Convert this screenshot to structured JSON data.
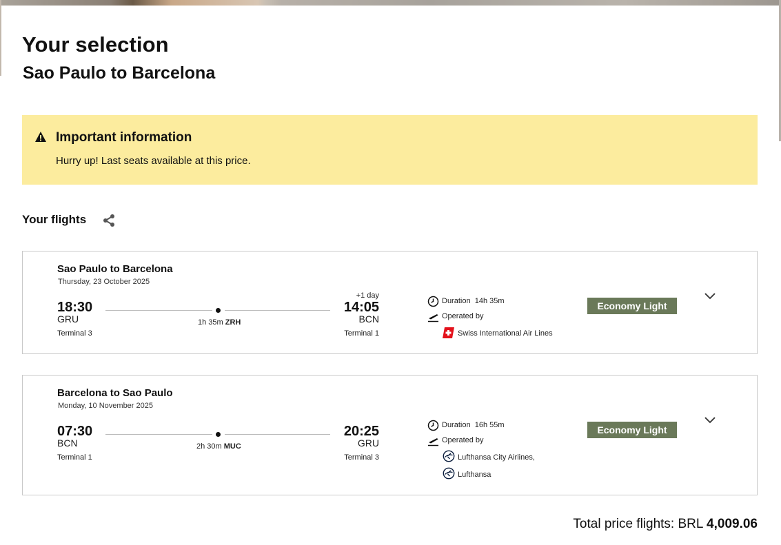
{
  "header": {
    "title": "Your selection",
    "subtitle": "Sao Paulo to Barcelona"
  },
  "info": {
    "icon": "warning-icon",
    "title": "Important information",
    "text": "Hurry up! Last seats available at this price.",
    "background": "#fcec9e"
  },
  "flights_section": {
    "title": "Your flights",
    "share_icon": "share-icon"
  },
  "flights": [
    {
      "route": "Sao Paulo to Barcelona",
      "date": "Thursday, 23 October 2025",
      "depart_time": "18:30",
      "depart_code": "GRU",
      "depart_terminal": "Terminal 3",
      "arrive_time": "14:05",
      "arrive_code": "BCN",
      "arrive_terminal": "Terminal 1",
      "arrive_day_offset": "+1 day",
      "stop_duration": "1h 35m",
      "stop_code": "ZRH",
      "duration_label": "Duration",
      "duration": "14h 35m",
      "operated_label": "Operated by",
      "airlines": [
        "Swiss International Air Lines"
      ],
      "fare": "Economy Light"
    },
    {
      "route": "Barcelona to Sao Paulo",
      "date": "Monday, 10 November 2025",
      "depart_time": "07:30",
      "depart_code": "BCN",
      "depart_terminal": "Terminal 1",
      "arrive_time": "20:25",
      "arrive_code": "GRU",
      "arrive_terminal": "Terminal 3",
      "stop_duration": "2h 30m",
      "stop_code": "MUC",
      "duration_label": "Duration",
      "duration": "16h 55m",
      "operated_label": "Operated by",
      "airlines": [
        "Lufthansa City Airlines,",
        "Lufthansa"
      ],
      "fare": "Economy Light"
    }
  ],
  "total": {
    "label": "Total price flights: BRL",
    "amount": "4,009.06"
  },
  "colors": {
    "fare_badge": "#6a7959",
    "swiss_red": "#e3111b",
    "lufthansa_navy": "#0a1d3d"
  }
}
